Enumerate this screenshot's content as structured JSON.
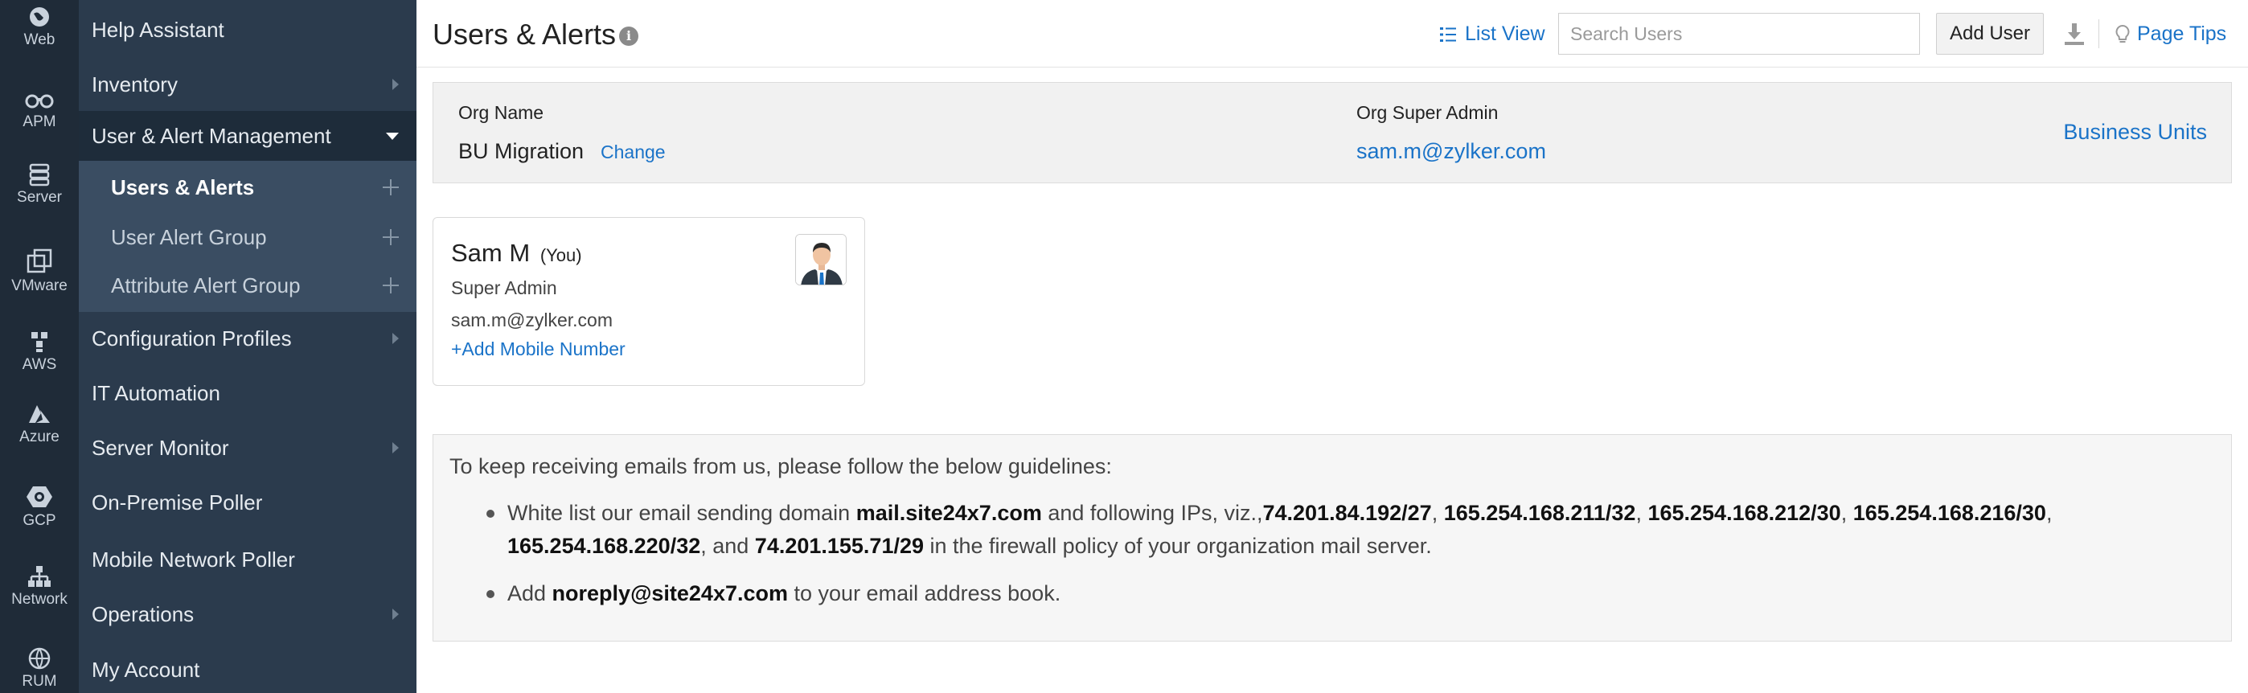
{
  "rail": {
    "items": [
      {
        "label": "Web",
        "icon": "globe-icon"
      },
      {
        "label": "APM",
        "icon": "binoculars-icon"
      },
      {
        "label": "Server",
        "icon": "server-icon"
      },
      {
        "label": "VMware",
        "icon": "vmware-icon"
      },
      {
        "label": "AWS",
        "icon": "aws-icon"
      },
      {
        "label": "Azure",
        "icon": "azure-icon"
      },
      {
        "label": "GCP",
        "icon": "gcp-icon"
      },
      {
        "label": "Network",
        "icon": "network-icon"
      },
      {
        "label": "RUM",
        "icon": "rum-icon"
      }
    ]
  },
  "menu": {
    "items": [
      {
        "label": "Help Assistant"
      },
      {
        "label": "Inventory"
      },
      {
        "label": "User & Alert Management"
      },
      {
        "label": "Configuration Profiles"
      },
      {
        "label": "IT Automation"
      },
      {
        "label": "Server Monitor"
      },
      {
        "label": "On-Premise Poller"
      },
      {
        "label": "Mobile Network Poller"
      },
      {
        "label": "Operations"
      },
      {
        "label": "My Account"
      }
    ],
    "subitems": [
      {
        "label": "Users & Alerts"
      },
      {
        "label": "User Alert Group"
      },
      {
        "label": "Attribute Alert Group"
      }
    ]
  },
  "header": {
    "title": "Users & Alerts",
    "info_glyph": "i",
    "list_view": "List View",
    "search_placeholder": "Search Users",
    "add_user": "Add User",
    "page_tips": "Page Tips"
  },
  "org": {
    "name_label": "Org Name",
    "name_value": "BU Migration",
    "change_link": "Change",
    "admin_label": "Org Super Admin",
    "admin_email": "sam.m@zylker.com",
    "business_units": "Business Units"
  },
  "user_card": {
    "name": "Sam M",
    "you": "(You)",
    "role": "Super Admin",
    "email": "sam.m@zylker.com",
    "add_mobile": "+Add Mobile Number"
  },
  "guidelines": {
    "intro": "To keep receiving emails from us, please follow the below guidelines:",
    "b1_t1": "White list our email sending domain ",
    "b1_domain": "mail.site24x7.com",
    "b1_t2": " and following IPs, viz.,",
    "ip1": "74.201.84.192/27",
    "sep1": ", ",
    "ip2": "165.254.168.211/32",
    "sep2": ", ",
    "ip3": "165.254.168.212/30",
    "sep3": ", ",
    "ip4": "165.254.168.216/30",
    "sep4": ", ",
    "ip5": "165.254.168.220/32",
    "b1_and": ", and ",
    "ip6": "74.201.155.71/29",
    "b1_t3": " in the firewall policy of your organization mail server.",
    "b2_t1": "Add ",
    "b2_email": "noreply@site24x7.com",
    "b2_t2": " to your email address book."
  },
  "colors": {
    "rail_bg": "#1f2b38",
    "menu_bg": "#2b3b4d",
    "submenu_bg": "#3a4d62",
    "link": "#1a73c8"
  }
}
